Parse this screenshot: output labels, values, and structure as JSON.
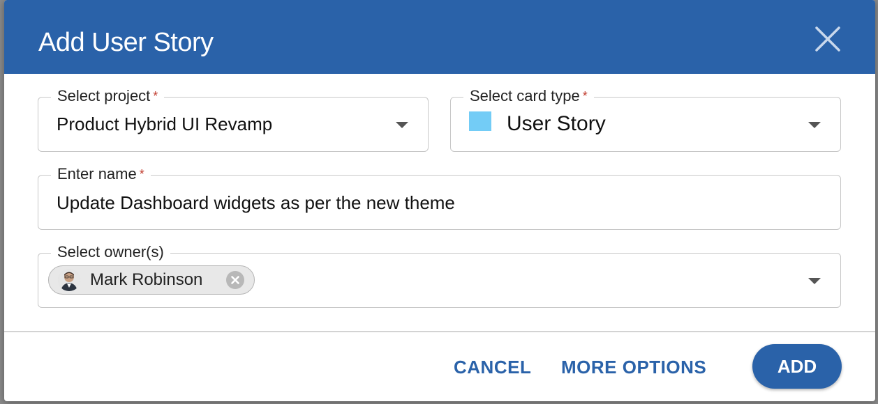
{
  "dialog": {
    "title": "Add User Story",
    "close_icon": "close-icon"
  },
  "project": {
    "label": "Select project",
    "required_mark": "*",
    "value": "Product Hybrid UI Revamp",
    "icon": "caret-down-icon"
  },
  "card_type": {
    "label": "Select card type",
    "required_mark": "*",
    "value": "User Story",
    "swatch_color": "#73ccf6",
    "icon": "caret-down-icon"
  },
  "name": {
    "label": "Enter name",
    "required_mark": "*",
    "value": "Update Dashboard widgets as per the new theme"
  },
  "owners": {
    "label": "Select owner(s)",
    "chips": [
      {
        "name": "Mark Robinson",
        "avatar_icon": "user-avatar",
        "remove_icon": "remove-circle-icon"
      }
    ],
    "icon": "caret-down-icon"
  },
  "footer": {
    "cancel_label": "CANCEL",
    "more_options_label": "MORE OPTIONS",
    "add_label": "ADD"
  },
  "colors": {
    "primary": "#2a62a9",
    "required": "#c0392b"
  }
}
